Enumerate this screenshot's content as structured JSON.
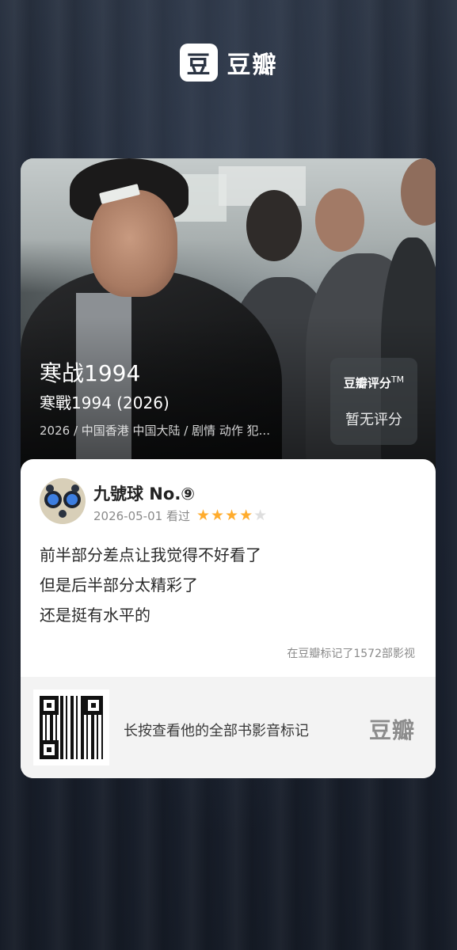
{
  "brand": {
    "logo_glyph": "豆",
    "name": "豆瓣"
  },
  "movie": {
    "title": "寒战1994",
    "original_title": "寒戰1994 (2026)",
    "meta": "2026 / 中国香港 中国大陆 / 剧情 动作 犯...",
    "rating_label": "豆瓣评分",
    "rating_mark": "TM",
    "rating_value": "暂无评分"
  },
  "review": {
    "user_name": "九號球 No.⑨",
    "date_label": "2026-05-01 看过",
    "stars": 4,
    "stars_max": 5,
    "lines": [
      "前半部分差点让我觉得不好看了",
      "但是后半部分太精彩了",
      "还是挺有水平的"
    ],
    "marked_count_text": "在豆瓣标记了1572部影视"
  },
  "footer": {
    "cta_text": "长按查看他的全部书影音标记",
    "brand": "豆瓣"
  },
  "colors": {
    "background": "#1c2330",
    "star_on": "#ffac2d",
    "star_off": "#dedede"
  }
}
